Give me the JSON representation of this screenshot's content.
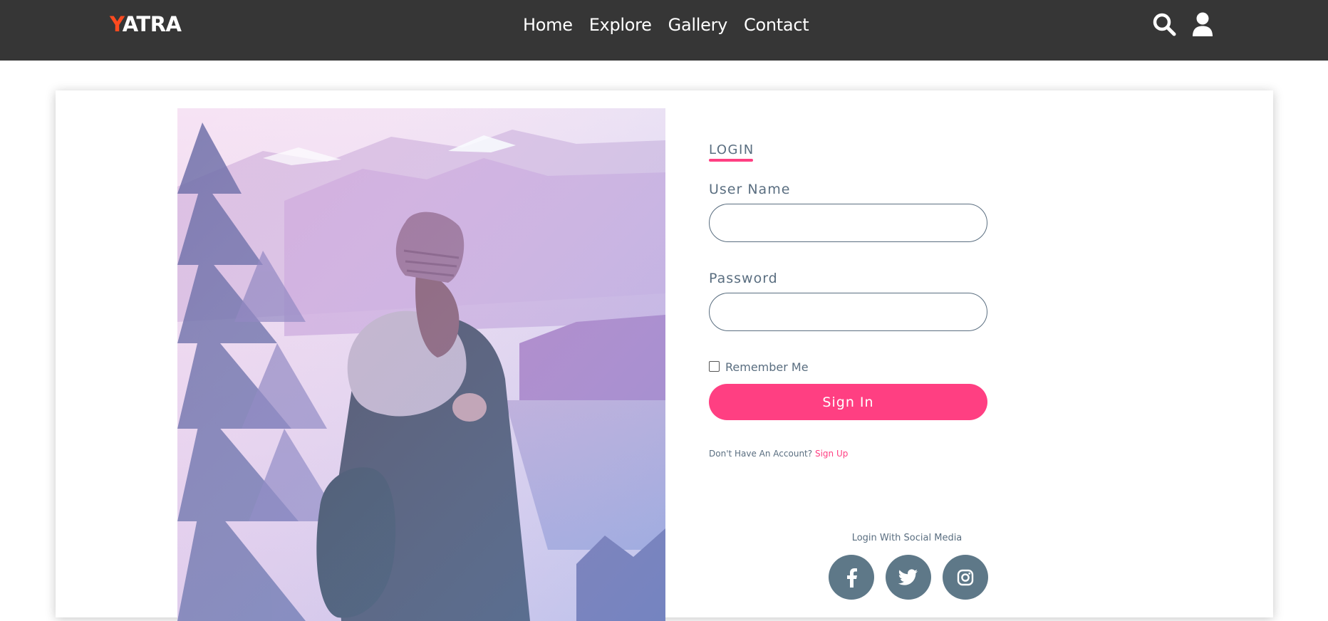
{
  "brand": {
    "logo_first": "Y",
    "logo_rest": "ATRA",
    "accent_color": "#ff4a1f"
  },
  "nav": {
    "links": [
      "Home",
      "Explore",
      "Gallery",
      "Contact"
    ],
    "search_icon": "search-icon",
    "user_icon": "user-icon"
  },
  "login": {
    "title": "LOGIN",
    "username_label": "User Name",
    "username_value": "",
    "password_label": "Password",
    "password_value": "",
    "remember_label": "Remember Me",
    "remember_checked": false,
    "submit_label": "Sign In",
    "no_account_text": "Don't Have An Account?",
    "signup_label": "Sign Up",
    "accent_color": "#ff3f82"
  },
  "social": {
    "title": "Login With Social Media",
    "icons": [
      "facebook-icon",
      "twitter-icon",
      "instagram-icon"
    ]
  },
  "colors": {
    "navbar": "#363636",
    "text_muted": "#5a6e80",
    "social_bg": "#5e7888"
  }
}
